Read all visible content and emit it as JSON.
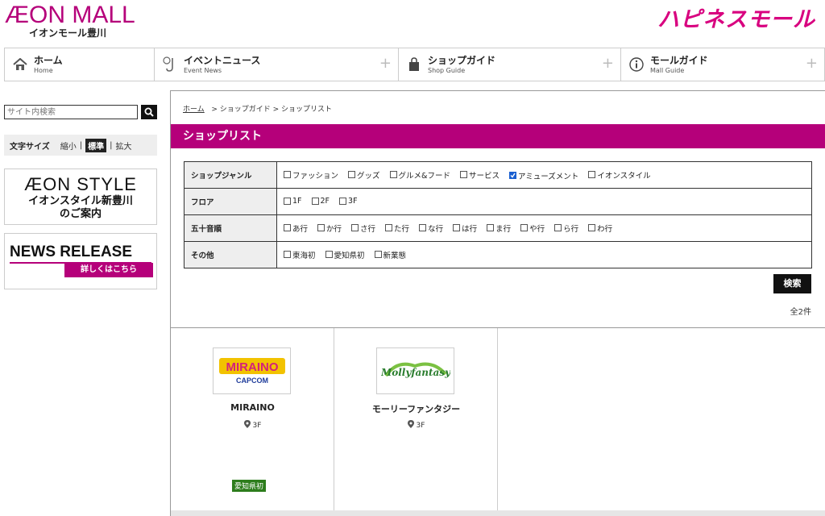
{
  "header": {
    "brand": "ÆON MALL",
    "mall_name": "イオンモール豊川",
    "happiness_logo": "ハピネスモール"
  },
  "nav": [
    {
      "ja": "ホーム",
      "en": "Home",
      "icon": "home-icon"
    },
    {
      "ja": "イベントニュース",
      "en": "Event News",
      "icon": "saxophone-icon",
      "plus": "+"
    },
    {
      "ja": "ショップガイド",
      "en": "Shop Guide",
      "icon": "shopping-bag-icon",
      "plus": "+"
    },
    {
      "ja": "モールガイド",
      "en": "Mall Guide",
      "icon": "info-icon",
      "plus": "+"
    }
  ],
  "sidebar": {
    "search_placeholder": "サイト内検索",
    "fontsize_label": "文字サイズ",
    "fontsize_small": "縮小",
    "fontsize_standard": "標準",
    "fontsize_large": "拡大",
    "sep": "|",
    "banner1_brand": "ÆON STYLE",
    "banner1_line1": "イオンスタイル新豊川",
    "banner1_line2": "のご案内",
    "banner2_title": "NEWS RELEASE",
    "banner2_more": "詳しくはこちら"
  },
  "main": {
    "breadcrumb_home": "ホーム",
    "breadcrumb_rest": "> ショップガイド > ショップリスト",
    "title": "ショップリスト",
    "filters": {
      "genre_label": "ショップジャンル",
      "genre_options": [
        "ファッション",
        "グッズ",
        "グルメ&フード",
        "サービス",
        "アミューズメント",
        "イオンスタイル"
      ],
      "floor_label": "フロア",
      "floor_options": [
        "1F",
        "2F",
        "3F"
      ],
      "kana_label": "五十音順",
      "kana_options": [
        "あ行",
        "か行",
        "さ行",
        "た行",
        "な行",
        "は行",
        "ま行",
        "や行",
        "ら行",
        "わ行"
      ],
      "other_label": "その他",
      "other_options": [
        "東海初",
        "愛知県初",
        "新業態"
      ]
    },
    "search_button": "検索",
    "count": "全2件"
  },
  "shops": [
    {
      "name": "MIRAINO",
      "floor": "3F",
      "tag": "愛知県初",
      "logo_text": "MIRAINO",
      "logo_sub": "CAPCOM"
    },
    {
      "name": "モーリーファンタジー",
      "floor": "3F",
      "logo_text": "Mollyfantasy"
    }
  ],
  "colors": {
    "brand": "#b5007a",
    "happiness": "#d8007f",
    "tag_green": "#2d7d1c",
    "checked": "#1a5fd0"
  }
}
